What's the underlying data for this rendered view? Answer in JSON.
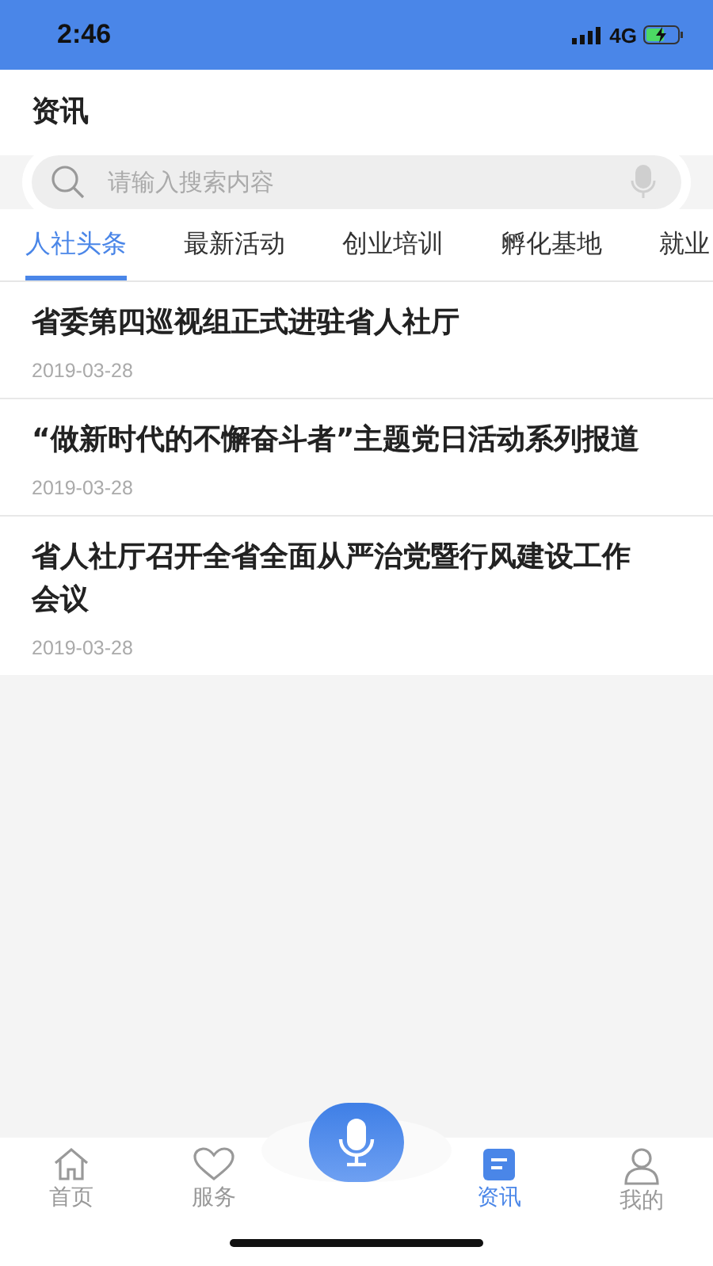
{
  "status_bar": {
    "time": "2:46",
    "network": "4G"
  },
  "header": {
    "title": "资讯"
  },
  "search": {
    "placeholder": "请输入搜索内容"
  },
  "tabs": [
    {
      "label": "人社头条",
      "selected": true
    },
    {
      "label": "最新活动",
      "selected": false
    },
    {
      "label": "创业培训",
      "selected": false
    },
    {
      "label": "孵化基地",
      "selected": false
    },
    {
      "label": "就业",
      "selected": false
    }
  ],
  "articles": [
    {
      "title": "省委第四巡视组正式进驻省人社厅",
      "date": "2019-03-28"
    },
    {
      "title": "“做新时代的不懈奋斗者”主题党日活动系列报道",
      "date": "2019-03-28"
    },
    {
      "title": "省人社厅召开全省全面从严治党暨行风建设工作会议",
      "date": "2019-03-28"
    }
  ],
  "bottom_nav": [
    {
      "kind": "home",
      "label": "首页",
      "selected": false
    },
    {
      "kind": "heart",
      "label": "服务",
      "selected": false
    },
    {
      "kind": "voice"
    },
    {
      "kind": "news",
      "label": "资讯",
      "selected": true
    },
    {
      "kind": "user",
      "label": "我的",
      "selected": false
    }
  ]
}
